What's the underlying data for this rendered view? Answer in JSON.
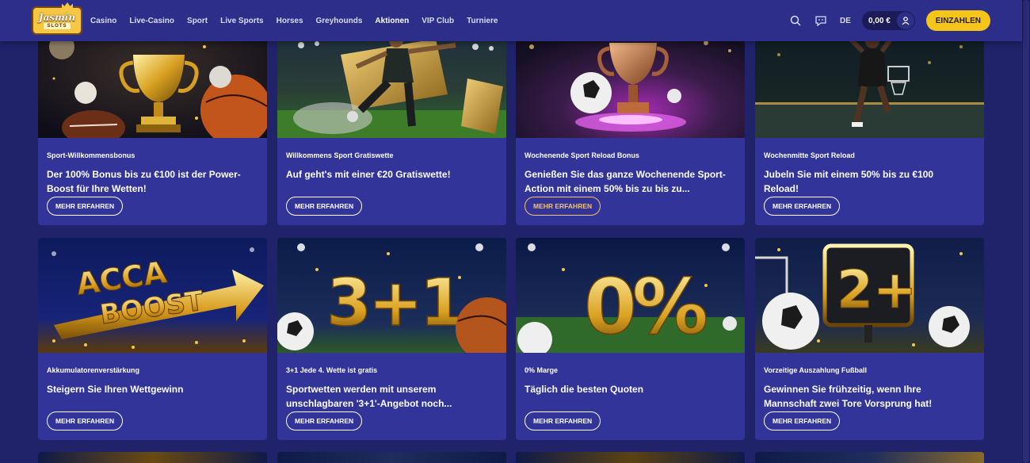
{
  "header": {
    "logo_word": "Jasmin",
    "logo_sub": "SLOTS",
    "nav": [
      "Casino",
      "Live-Casino",
      "Sport",
      "Live Sports",
      "Horses",
      "Greyhounds",
      "Aktionen",
      "VIP Club",
      "Turniere"
    ],
    "active_nav": "Aktionen",
    "language": "DE",
    "balance": "0,00 €",
    "deposit_label": "EINZAHLEN"
  },
  "colors": {
    "page_bg": "#20226a",
    "header_bg": "#2c2e8a",
    "card_bg": "#33349a",
    "deposit": "#f5c518",
    "button_hover": "#f4c36a"
  },
  "promotions": [
    {
      "tag": "Sport-Willkommensbonus",
      "title": "Der 100% Bonus bis zu €100 ist der Power-Boost für Ihre Wetten!",
      "button": "MEHR ERFAHREN",
      "image": "trophy-sports-balls"
    },
    {
      "tag": "Willkommens Sport Gratiswette",
      "title": "Auf geht's mit einer €20 Gratiswette!",
      "button": "MEHR ERFAHREN",
      "image": "soccer-player-ticket"
    },
    {
      "tag": "Wochenende Sport Reload Bonus",
      "title": "Genießen Sie das ganze Wochenende Sport-Action mit einem 50% bis zu bis zu...",
      "button": "MEHR ERFAHREN",
      "image": "trophy-stage-soccer"
    },
    {
      "tag": "Wochenmitte Sport Reload",
      "title": "Jubeln Sie mit einem 50% bis zu €100 Reload!",
      "button": "MEHR ERFAHREN",
      "image": "basketball-dunk"
    },
    {
      "tag": "Akkumulatorenverstärkung",
      "title": "Steigern Sie Ihren Wettgewinn",
      "button": "MEHR ERFAHREN",
      "image": "acca-boost",
      "image_text": [
        "ACCA",
        "BOOST"
      ]
    },
    {
      "tag": "3+1 Jede 4. Wette ist gratis",
      "title": "Sportwetten werden mit unserem unschlagbaren '3+1'-Angebot noch...",
      "button": "MEHR ERFAHREN",
      "image": "three-plus-one",
      "image_text": [
        "3+1"
      ]
    },
    {
      "tag": "0% Marge",
      "title": "Täglich die besten Quoten",
      "button": "MEHR ERFAHREN",
      "image": "zero-percent",
      "image_text": [
        "0%"
      ]
    },
    {
      "tag": "Vorzeitige Auszahlung Fußball",
      "title": "Gewinnen Sie frühzeitig, wenn Ihre Mannschaft zwei Tore Vorsprung hat!",
      "button": "MEHR ERFAHREN",
      "image": "two-plus-sign",
      "image_text": [
        "2+"
      ]
    }
  ]
}
